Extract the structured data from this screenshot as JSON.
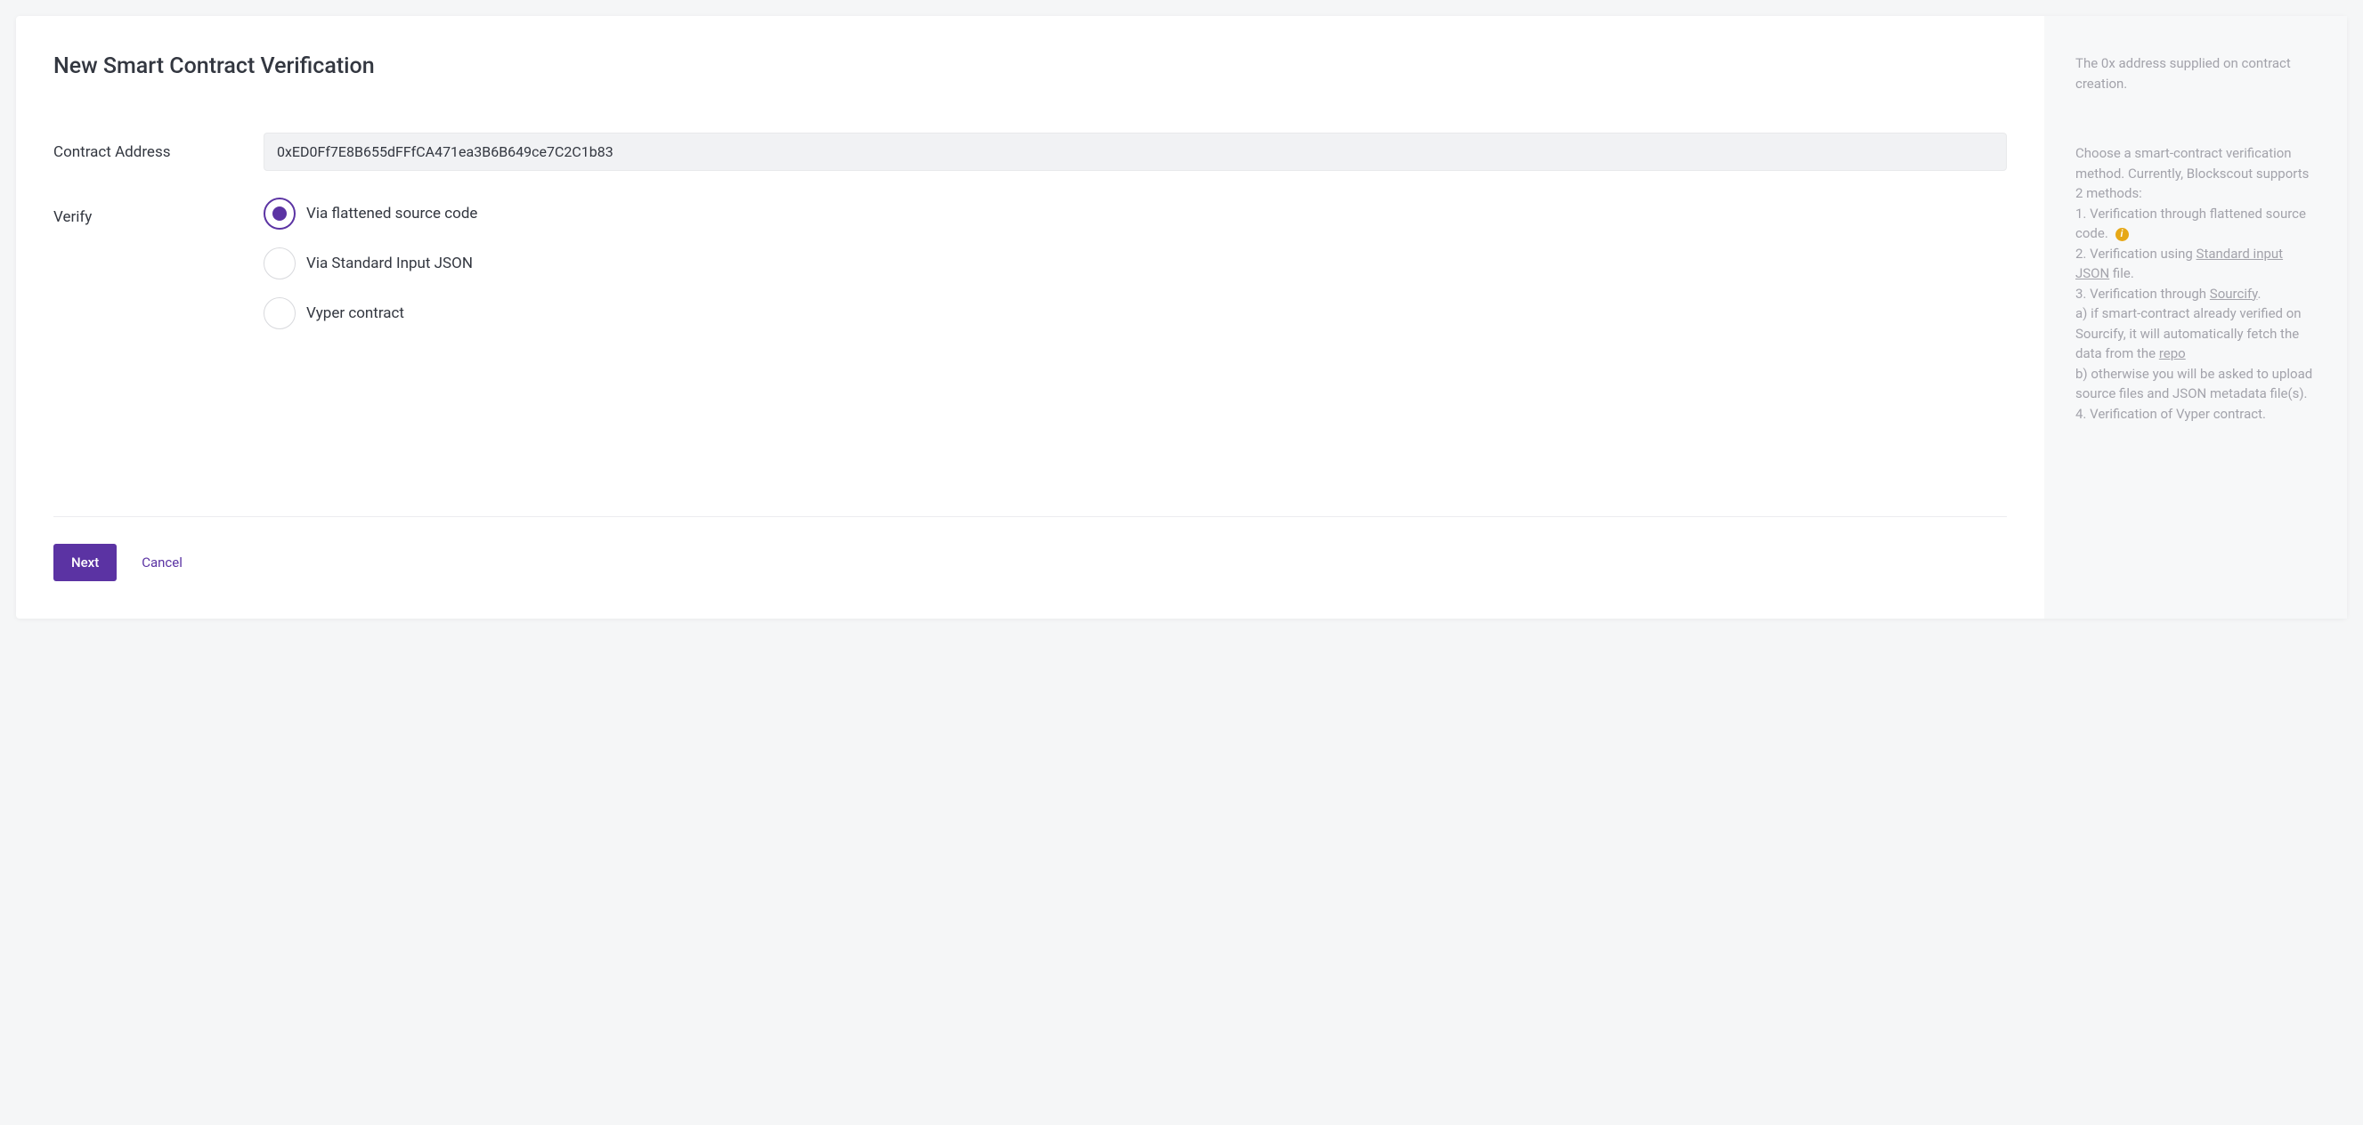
{
  "title": "New Smart Contract Verification",
  "form": {
    "contract_address_label": "Contract Address",
    "contract_address_value": "0xED0Ff7E8B655dFFfCA471ea3B6B649ce7C2C1b83",
    "verify_label": "Verify",
    "options": [
      {
        "label": "Via flattened source code",
        "selected": true
      },
      {
        "label": "Via Standard Input JSON",
        "selected": false
      },
      {
        "label": "Vyper contract",
        "selected": false
      }
    ]
  },
  "actions": {
    "next": "Next",
    "cancel": "Cancel"
  },
  "help": {
    "contract_note": "The 0x address supplied on contract creation.",
    "intro": "Choose a smart-contract verification method. Currently, Blockscout supports 2 methods:",
    "m1_pre": "1. Verification through flattened source code. ",
    "m2_pre": "2. Verification using ",
    "m2_link": "Standard input JSON",
    "m2_post": " file.",
    "m3_pre": "3. Verification through ",
    "m3_link": "Sourcify",
    "m3_post": ".",
    "m3a_pre": "a) if smart-contract already verified on Sourcify, it will automatically fetch the data from the ",
    "m3a_link": "repo",
    "m3b": "b) otherwise you will be asked to upload source files and JSON metadata file(s).",
    "m4": "4. Verification of Vyper contract."
  }
}
